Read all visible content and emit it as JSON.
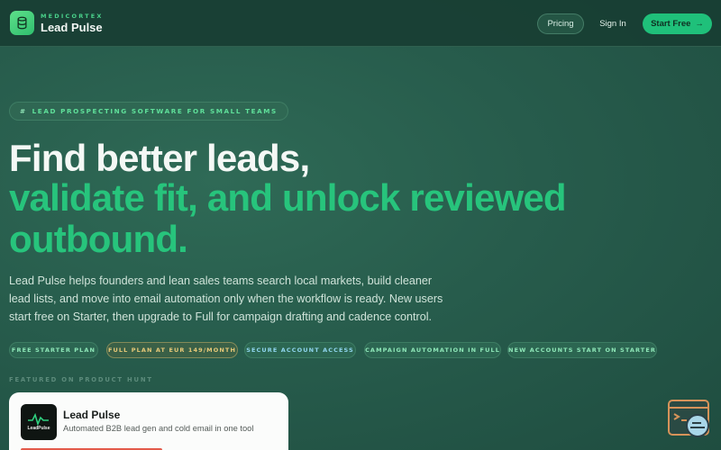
{
  "nav": {
    "brand_eyebrow": "MEDICORTEX",
    "brand_name": "Lead Pulse",
    "pricing": "Pricing",
    "sign_in": "Sign In",
    "start_free": "Start Free",
    "start_arrow": "→"
  },
  "hero": {
    "eyebrow": "LEAD PROSPECTING SOFTWARE FOR SMALL TEAMS",
    "eyebrow_icon": "#",
    "title_line1": "Find better leads,",
    "title_line2": "validate fit, and unlock reviewed",
    "title_line3": "outbound.",
    "description": "Lead Pulse helps founders and lean sales teams search local markets, build cleaner lead lists, and move into email automation only when the workflow is ready. New users start free on Starter, then upgrade to Full for campaign drafting and cadence control.",
    "tags": [
      "FREE STARTER PLAN",
      "FULL PLAN AT EUR 149/MONTH",
      "SECURE ACCOUNT ACCESS",
      "CAMPAIGN AUTOMATION IN FULL",
      "NEW ACCOUNTS START ON STARTER"
    ]
  },
  "featured": {
    "label": "FEATURED ON PRODUCT HUNT",
    "card_title": "Lead Pulse",
    "card_subtitle": "Automated B2B lead gen and cold email in one tool",
    "logo_text": "LeadPulse"
  },
  "colors": {
    "accent_green": "#27c47c",
    "button_green": "#1fc07a",
    "background": "#275c4c",
    "gold_tag": "#e7c978",
    "blue_tag": "#8fd5ee"
  },
  "icons": {
    "logo": "database-icon",
    "start_arrow": "arrow-right-icon",
    "eyebrow": "hash-icon",
    "chat": "chat-support-icon"
  }
}
